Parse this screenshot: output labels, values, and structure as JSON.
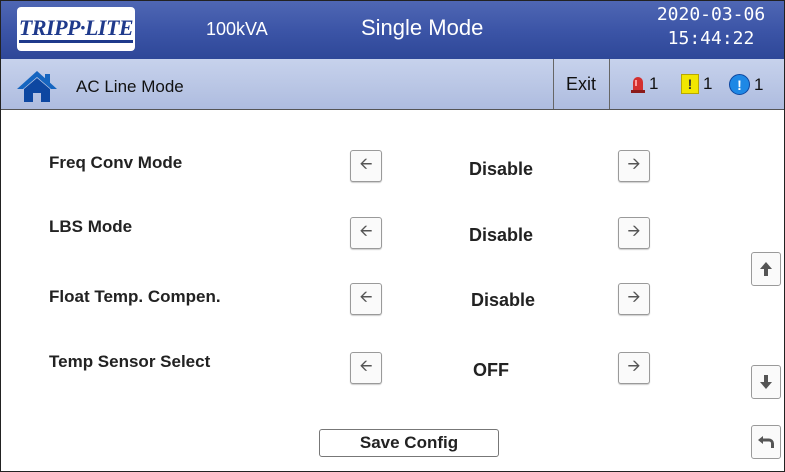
{
  "header": {
    "logo_text": "TRIPP·LITE",
    "rating": "100kVA",
    "mode": "Single Mode",
    "date": "2020-03-06",
    "time": "15:44:22"
  },
  "nav": {
    "title": "AC Line Mode",
    "exit_label": "Exit",
    "alarms": [
      {
        "icon": "red-alarm-light-icon",
        "count": "1"
      },
      {
        "icon": "yellow-warning-icon",
        "count": "1"
      },
      {
        "icon": "blue-info-icon",
        "count": "1"
      }
    ]
  },
  "settings": [
    {
      "label": "Freq Conv Mode",
      "value": "Disable"
    },
    {
      "label": "LBS Mode",
      "value": "Disable"
    },
    {
      "label": "Float Temp. Compen.",
      "value": "Disable"
    },
    {
      "label": "Temp Sensor Select",
      "value": "OFF"
    }
  ],
  "save_label": "Save Config",
  "colors": {
    "header": "#3c55a7",
    "navbar": "#b9c5e4",
    "alarm_red": "#d32f2f",
    "alarm_yellow": "#f2e600",
    "alarm_blue": "#1e88e5"
  }
}
